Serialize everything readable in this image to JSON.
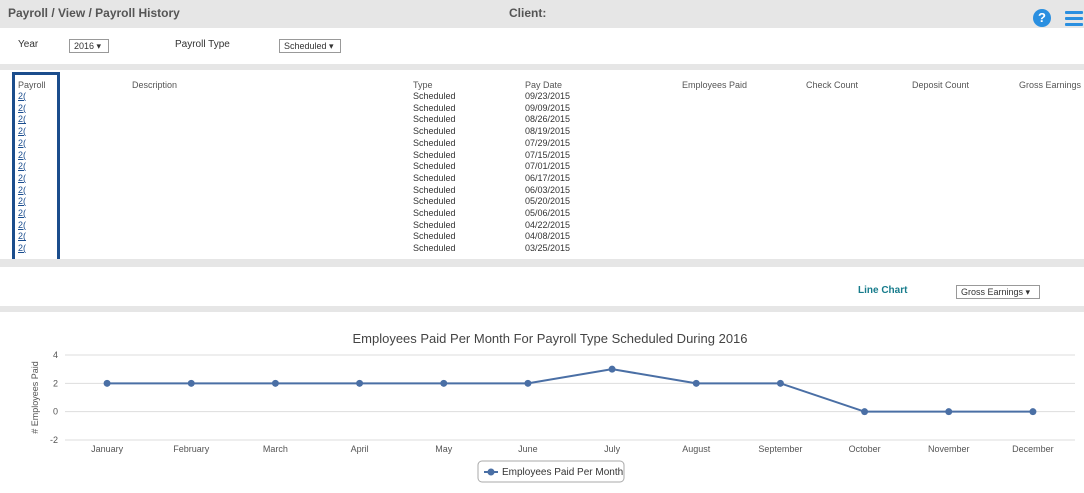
{
  "header": {
    "breadcrumb": "Payroll / View / Payroll History",
    "client_label": "Client:",
    "help_icon": "question-circle-icon",
    "menu_icon": "list-menu-icon"
  },
  "filters": {
    "year_label": "Year",
    "year_value": "2016 ▾",
    "payroll_type_label": "Payroll Type",
    "payroll_type_value": "Scheduled ▾"
  },
  "table": {
    "headers": [
      "Payroll",
      "Description",
      "Type",
      "Pay Date",
      "Employees Paid",
      "Check Count",
      "Deposit Count",
      "Gross Earnings"
    ],
    "rows": [
      {
        "payroll": "2(",
        "type": "Scheduled",
        "date": "09/23/2015"
      },
      {
        "payroll": "2(",
        "type": "Scheduled",
        "date": "09/09/2015"
      },
      {
        "payroll": "2(",
        "type": "Scheduled",
        "date": "08/26/2015"
      },
      {
        "payroll": "2(",
        "type": "Scheduled",
        "date": "08/19/2015"
      },
      {
        "payroll": "2(",
        "type": "Scheduled",
        "date": "07/29/2015"
      },
      {
        "payroll": "2(",
        "type": "Scheduled",
        "date": "07/15/2015"
      },
      {
        "payroll": "2(",
        "type": "Scheduled",
        "date": "07/01/2015"
      },
      {
        "payroll": "2(",
        "type": "Scheduled",
        "date": "06/17/2015"
      },
      {
        "payroll": "2(",
        "type": "Scheduled",
        "date": "06/03/2015"
      },
      {
        "payroll": "2(",
        "type": "Scheduled",
        "date": "05/20/2015"
      },
      {
        "payroll": "2(",
        "type": "Scheduled",
        "date": "05/06/2015"
      },
      {
        "payroll": "2(",
        "type": "Scheduled",
        "date": "04/22/2015"
      },
      {
        "payroll": "2(",
        "type": "Scheduled",
        "date": "04/08/2015"
      },
      {
        "payroll": "2(",
        "type": "Scheduled",
        "date": "03/25/2015"
      }
    ]
  },
  "chart_controls": {
    "line_chart_label": "Line Chart",
    "metric_select": "Gross Earnings ▾"
  },
  "colors": {
    "accent": "#2a8fe0",
    "series": "#4a6fa5",
    "highlight": "#1b4d8c",
    "chart_link": "#177c8c"
  },
  "chart_data": {
    "type": "line",
    "title": "Employees Paid Per Month For Payroll Type Scheduled During 2016",
    "xlabel": "",
    "ylabel": "# Employees Paid",
    "categories": [
      "January",
      "February",
      "March",
      "April",
      "May",
      "June",
      "July",
      "August",
      "September",
      "October",
      "November",
      "December"
    ],
    "series": [
      {
        "name": "Employees Paid Per Month",
        "values": [
          2,
          2,
          2,
          2,
          2,
          2,
          3,
          2,
          2,
          0,
          0,
          0
        ]
      }
    ],
    "ylim": [
      -2,
      4
    ],
    "yticks": [
      "4",
      "2",
      "0",
      "-2"
    ],
    "grid": true,
    "legend_position": "bottom"
  }
}
